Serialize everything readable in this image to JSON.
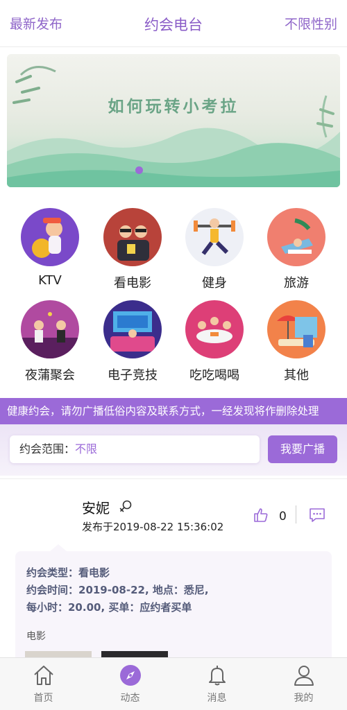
{
  "header": {
    "left": "最新发布",
    "title": "约会电台",
    "right": "不限性别"
  },
  "banner": {
    "title": "如何玩转小考拉"
  },
  "categories": [
    {
      "label": "KTV",
      "icon": "ktv-icon"
    },
    {
      "label": "看电影",
      "icon": "movie-icon"
    },
    {
      "label": "健身",
      "icon": "fitness-icon"
    },
    {
      "label": "旅游",
      "icon": "travel-icon"
    },
    {
      "label": "夜蒲聚会",
      "icon": "party-icon"
    },
    {
      "label": "电子竞技",
      "icon": "esports-icon"
    },
    {
      "label": "吃吃喝喝",
      "icon": "dining-icon"
    },
    {
      "label": "其他",
      "icon": "other-icon"
    }
  ],
  "notice": "健康约会，请勿广播低俗内容及联系方式，一经发现将作删除处理",
  "range": {
    "label": "约会范围：",
    "value": "不限"
  },
  "broadcast_label": "我要广播",
  "post": {
    "author": "安妮",
    "posted_at": "发布于2019-08-22 15:36:02",
    "likes": "0",
    "line1": "约会类型：看电影",
    "line2": "约会时间：2019-08-22, 地点：悉尼,",
    "line3": "每小时：20.00, 买单：应约者买单",
    "tag": "电影"
  },
  "tabs": [
    {
      "label": "首页",
      "icon": "home-icon"
    },
    {
      "label": "动态",
      "icon": "compass-icon"
    },
    {
      "label": "消息",
      "icon": "bell-icon"
    },
    {
      "label": "我的",
      "icon": "user-icon"
    }
  ],
  "colors": {
    "accent": "#9b6ad8",
    "header_text": "#8f66c9",
    "banner_text": "#6aa486"
  }
}
